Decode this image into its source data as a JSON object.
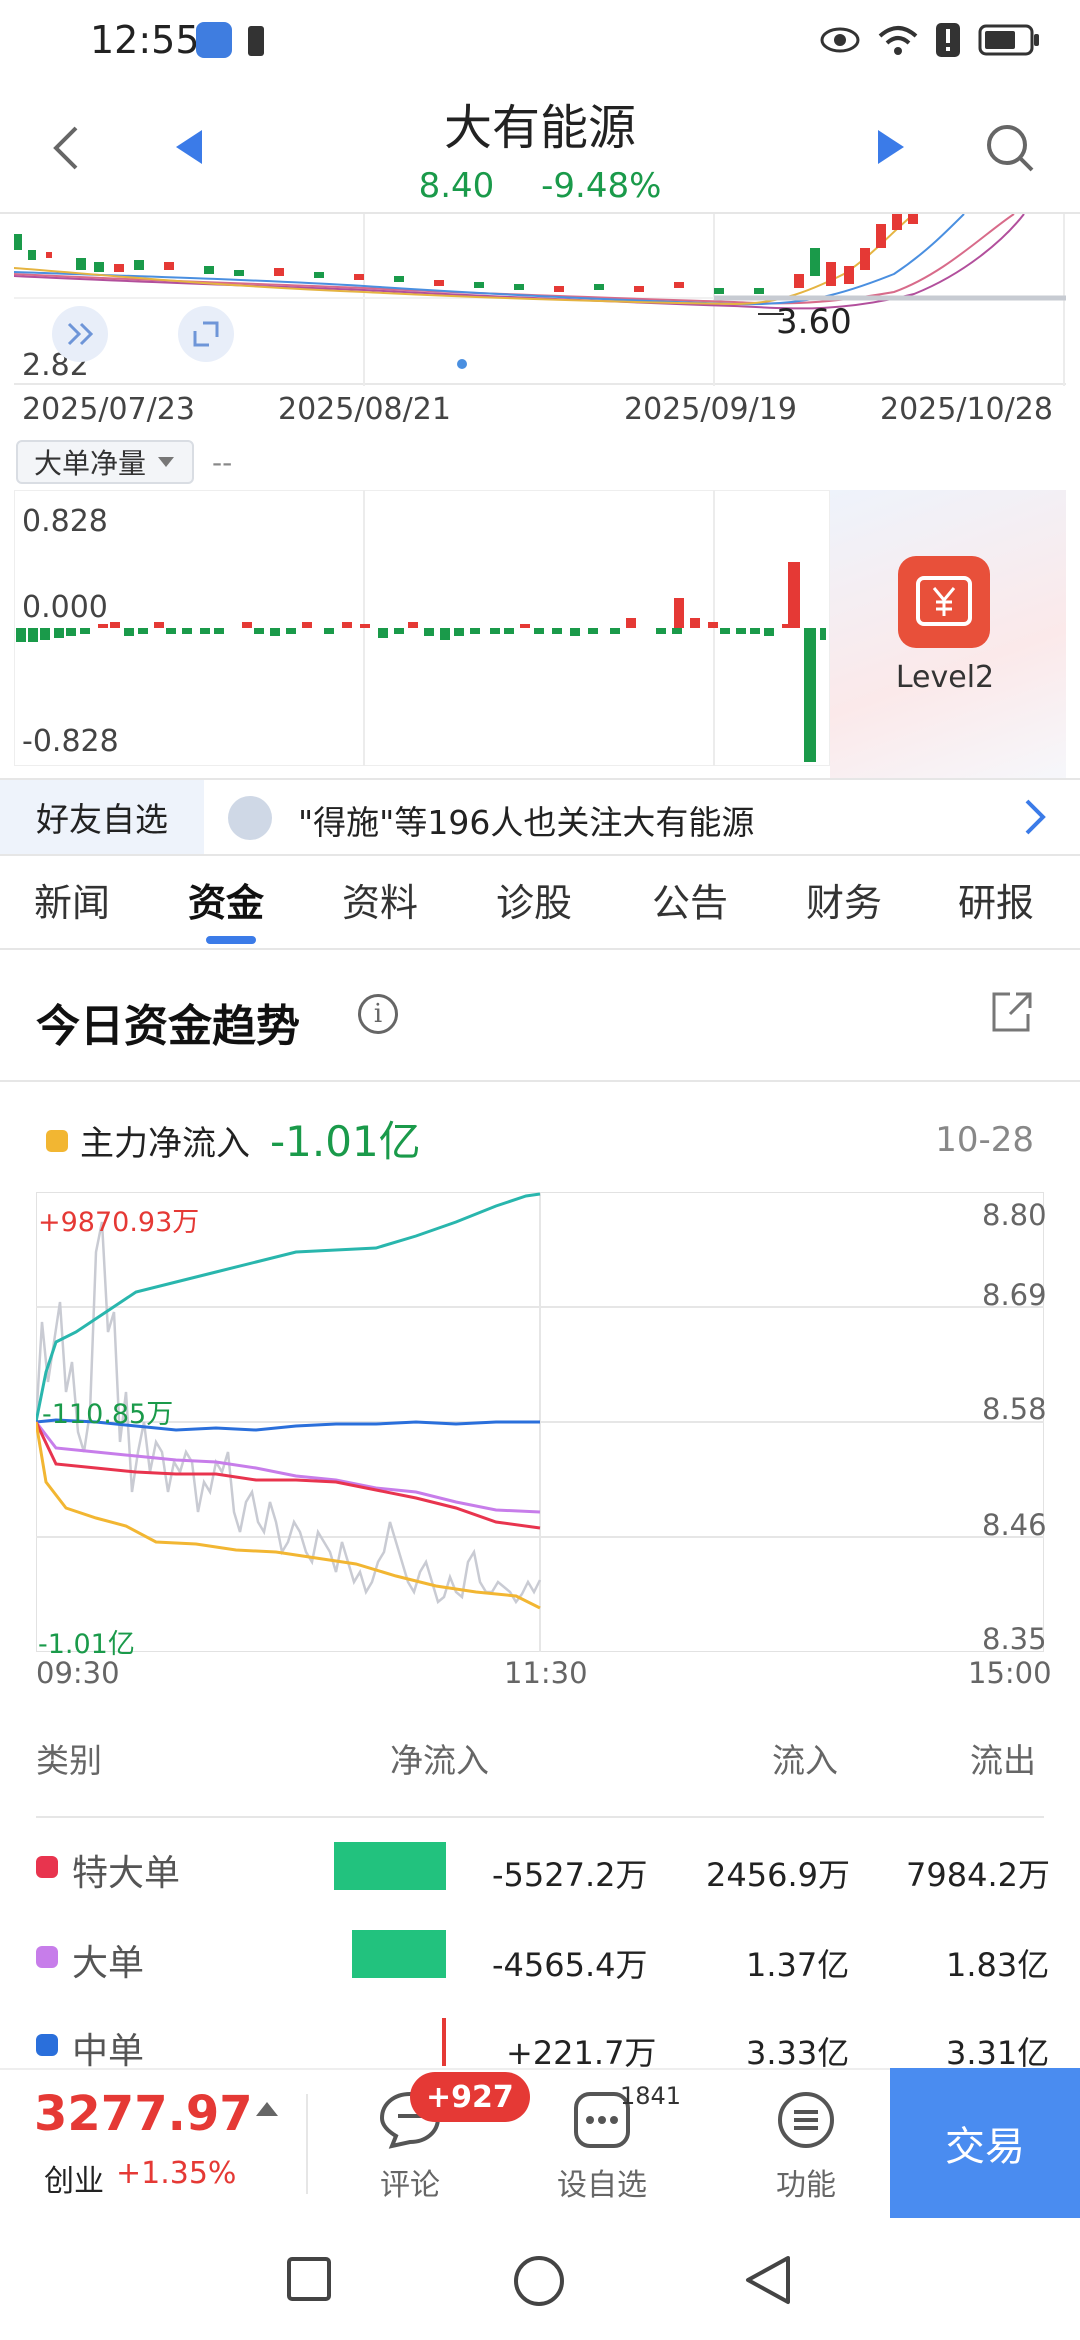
{
  "status": {
    "time": "12:55"
  },
  "header": {
    "title": "大有能源",
    "price": "8.40",
    "change_pct": "-9.48%"
  },
  "kline": {
    "min_marker": "3.60",
    "low_label": "2.82",
    "dates": [
      "2025/07/23",
      "2025/08/21",
      "2025/09/19",
      "2025/10/28"
    ]
  },
  "indicator": {
    "selector_label": "大单净量",
    "selector_value": "--",
    "y_labels": [
      "0.828",
      "0.000",
      "-0.828"
    ],
    "level2_label": "Level2"
  },
  "friends": {
    "tag": "好友自选",
    "text": "\"得施\"等196人也关注大有能源"
  },
  "tabs": [
    "新闻",
    "资金",
    "资料",
    "诊股",
    "公告",
    "财务",
    "研报"
  ],
  "active_tab": "资金",
  "trend": {
    "section_title": "今日资金趋势",
    "legend_label": "主力净流入",
    "legend_value": "-1.01亿",
    "date": "10-28",
    "flow_labels": {
      "max": "+9870.93万",
      "mid": "-110.85万",
      "min": "-1.01亿"
    },
    "price_axis": [
      "8.80",
      "8.69",
      "8.58",
      "8.46",
      "8.35"
    ],
    "time_axis": [
      "09:30",
      "11:30",
      "15:00"
    ]
  },
  "table": {
    "headers": [
      "类别",
      "净流入",
      "流入",
      "流出"
    ],
    "rows": [
      {
        "name": "特大单",
        "color": "#e8344e",
        "net": "-5527.2万",
        "in": "2456.9万",
        "out": "7984.2万"
      },
      {
        "name": "大单",
        "color": "#c77dea",
        "net": "-4565.4万",
        "in": "1.37亿",
        "out": "1.83亿"
      },
      {
        "name": "中单",
        "color": "#2a6fdb",
        "net": "+221.7万",
        "in": "3.33亿",
        "out": "3.31亿"
      }
    ]
  },
  "bottom": {
    "index_value": "3277.97",
    "index_name": "创业",
    "index_change": "+1.35%",
    "comment_label": "评论",
    "comment_badge": "+927",
    "watch_label": "设自选",
    "watch_count": "1841",
    "func_label": "功能",
    "trade_label": "交易"
  }
}
